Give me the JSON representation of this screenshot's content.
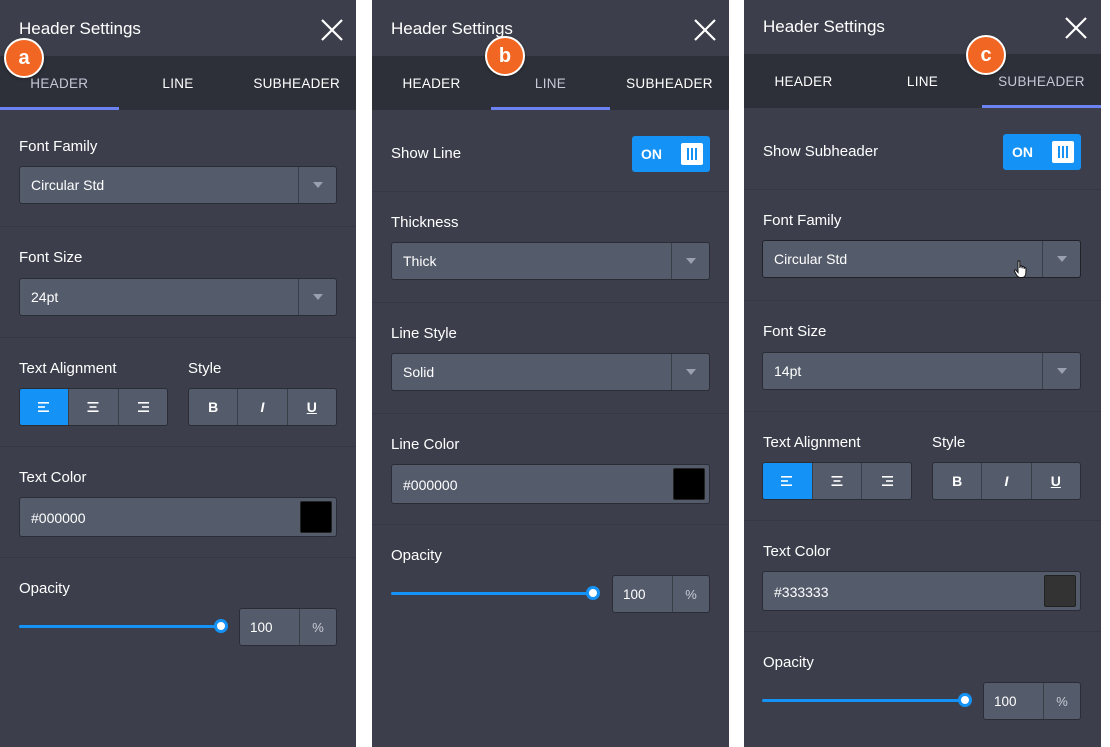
{
  "colors": {
    "accent": "#1592f5",
    "tab_indicator": "#6b82f0",
    "panel_bg": "#3c3f4b",
    "badge": "#f16622"
  },
  "panel_a": {
    "badge": "a",
    "title": "Header Settings",
    "tabs": [
      "HEADER",
      "LINE",
      "SUBHEADER"
    ],
    "active_tab": "HEADER",
    "font_family_label": "Font Family",
    "font_family_value": "Circular Std",
    "font_size_label": "Font Size",
    "font_size_value": "24pt",
    "text_alignment_label": "Text Alignment",
    "style_label": "Style",
    "style_buttons": [
      "B",
      "I",
      "U"
    ],
    "text_color_label": "Text Color",
    "text_color_value": "#000000",
    "swatch_color": "#000000",
    "opacity_label": "Opacity",
    "opacity_value": "100",
    "opacity_unit": "%"
  },
  "panel_b": {
    "badge": "b",
    "title": "Header Settings",
    "tabs": [
      "HEADER",
      "LINE",
      "SUBHEADER"
    ],
    "active_tab": "LINE",
    "show_line_label": "Show Line",
    "show_line_toggle": "ON",
    "thickness_label": "Thickness",
    "thickness_value": "Thick",
    "line_style_label": "Line Style",
    "line_style_value": "Solid",
    "line_color_label": "Line Color",
    "line_color_value": "#000000",
    "swatch_color": "#000000",
    "opacity_label": "Opacity",
    "opacity_value": "100",
    "opacity_unit": "%"
  },
  "panel_c": {
    "badge": "c",
    "title": "Header Settings",
    "tabs": [
      "HEADER",
      "LINE",
      "SUBHEADER"
    ],
    "active_tab": "SUBHEADER",
    "show_subheader_label": "Show Subheader",
    "show_subheader_toggle": "ON",
    "font_family_label": "Font Family",
    "font_family_value": "Circular Std",
    "font_size_label": "Font Size",
    "font_size_value": "14pt",
    "text_alignment_label": "Text Alignment",
    "style_label": "Style",
    "style_buttons": [
      "B",
      "I",
      "U"
    ],
    "text_color_label": "Text Color",
    "text_color_value": "#333333",
    "swatch_color": "#333333",
    "opacity_label": "Opacity",
    "opacity_value": "100",
    "opacity_unit": "%"
  }
}
